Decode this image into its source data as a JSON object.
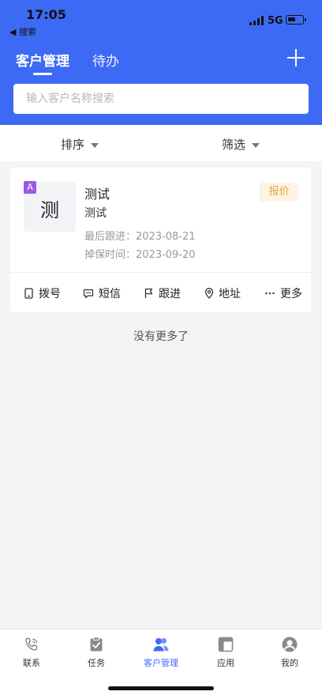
{
  "status": {
    "time": "17:05",
    "back_app": "◀ 搜索",
    "network": "5G"
  },
  "header": {
    "tabs": [
      {
        "label": "客户管理",
        "active": true
      },
      {
        "label": "待办",
        "active": false
      }
    ],
    "add_icon": "plus-icon"
  },
  "search": {
    "placeholder": "输入客户名称搜索",
    "value": ""
  },
  "filters": {
    "sort_label": "排序",
    "filter_label": "筛选"
  },
  "customers": [
    {
      "grade": "A",
      "avatar_char": "测",
      "name": "测试",
      "company": "测试",
      "last_follow": "最后跟进：2023-08-21",
      "drop_time": "掉保时间：2023-09-20",
      "badge": "报价",
      "actions": [
        "拨号",
        "短信",
        "跟进",
        "地址",
        "更多"
      ]
    }
  ],
  "list_end": "没有更多了",
  "tabbar": [
    {
      "label": "联系",
      "icon": "phone-icon"
    },
    {
      "label": "任务",
      "icon": "task-icon"
    },
    {
      "label": "客户管理",
      "icon": "customer-icon",
      "active": true
    },
    {
      "label": "应用",
      "icon": "apps-icon"
    },
    {
      "label": "我的",
      "icon": "profile-icon"
    }
  ],
  "colors": {
    "primary": "#3d6af5",
    "grade_badge": "#9b59e6",
    "quote_badge_bg": "#fdf4e3",
    "quote_badge_text": "#e8a33c"
  }
}
